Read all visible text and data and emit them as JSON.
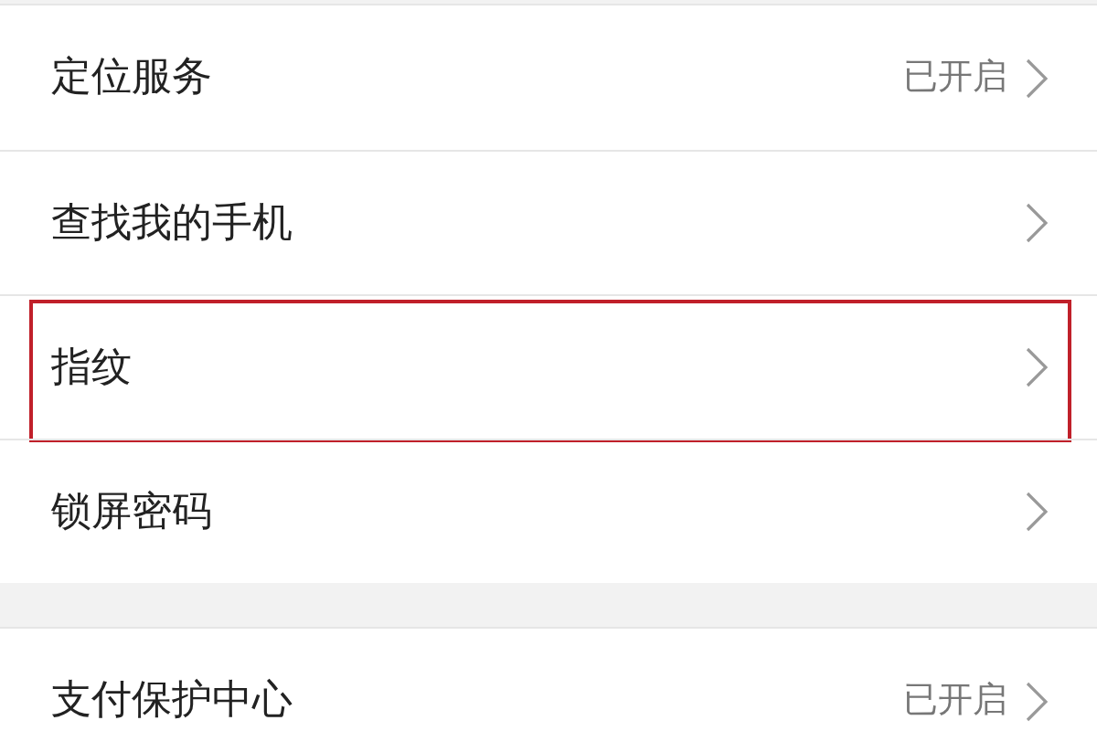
{
  "groups": [
    {
      "rows": [
        {
          "label": "定位服务",
          "value": "已开启",
          "highlighted": false
        },
        {
          "label": "查找我的手机",
          "highlighted": false
        },
        {
          "label": "指纹",
          "highlighted": true
        },
        {
          "label": "锁屏密码",
          "highlighted": false
        }
      ]
    },
    {
      "rows": [
        {
          "label": "支付保护中心",
          "value": "已开启",
          "highlighted": false
        }
      ]
    }
  ]
}
